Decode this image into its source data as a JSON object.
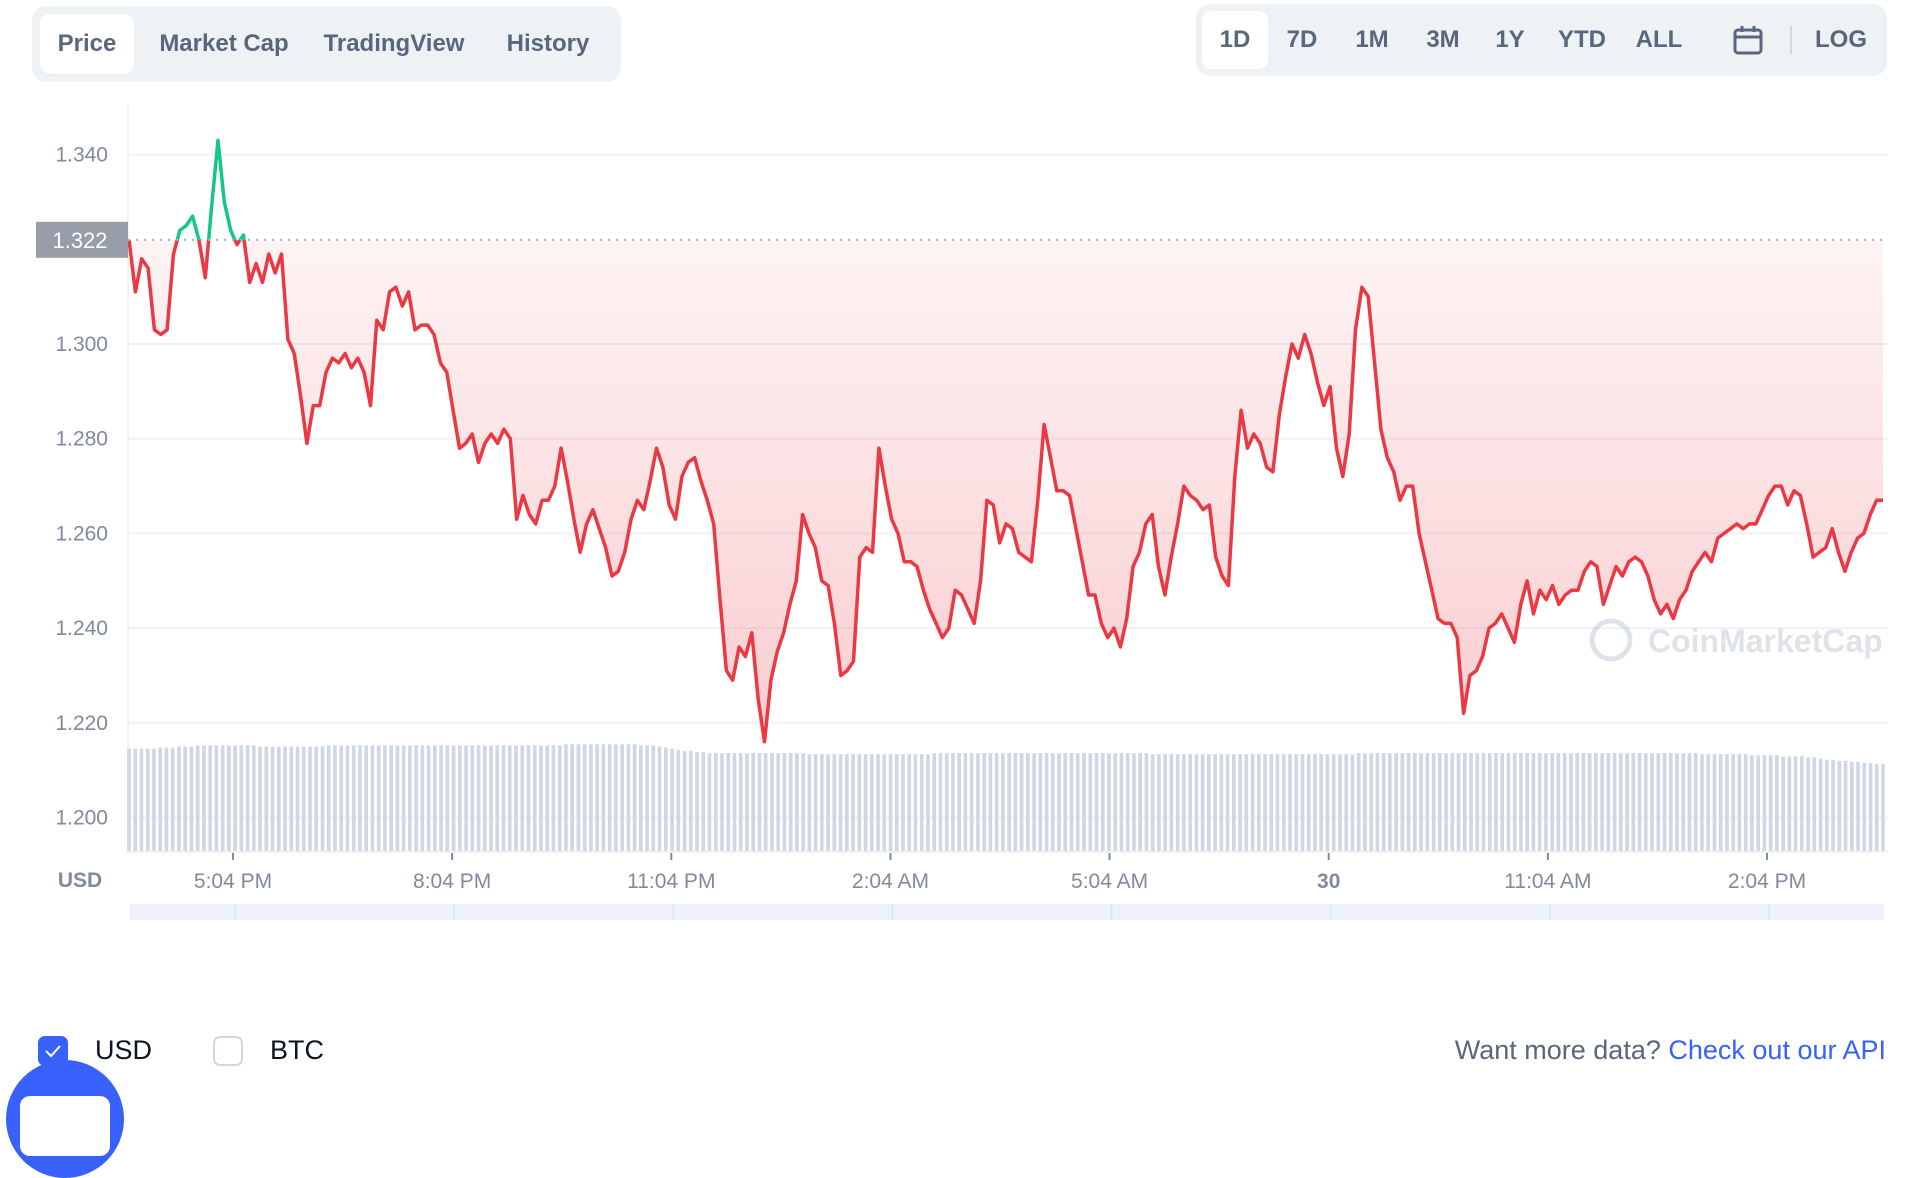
{
  "header": {
    "view_tabs": [
      {
        "label": "Price",
        "active": true
      },
      {
        "label": "Market Cap",
        "active": false
      },
      {
        "label": "TradingView",
        "active": false
      },
      {
        "label": "History",
        "active": false
      }
    ],
    "range_tabs": [
      {
        "label": "1D",
        "active": true
      },
      {
        "label": "7D",
        "active": false
      },
      {
        "label": "1M",
        "active": false
      },
      {
        "label": "3M",
        "active": false
      },
      {
        "label": "1Y",
        "active": false
      },
      {
        "label": "YTD",
        "active": false
      },
      {
        "label": "ALL",
        "active": false
      }
    ],
    "calendar_icon": "calendar-icon",
    "log_label": "LOG"
  },
  "chart_data": {
    "type": "line",
    "title": "",
    "currency_label": "USD",
    "ylabel": "",
    "xlabel": "",
    "ylim": [
      1.19,
      1.35
    ],
    "y_ticks": [
      "1.340",
      "1.300",
      "1.280",
      "1.260",
      "1.240",
      "1.220",
      "1.200"
    ],
    "y_tick_values": [
      1.34,
      1.3,
      1.28,
      1.26,
      1.24,
      1.22,
      1.2
    ],
    "x_ticks": [
      {
        "label": "5:04 PM",
        "bold": false
      },
      {
        "label": "8:04 PM",
        "bold": false
      },
      {
        "label": "11:04 PM",
        "bold": false
      },
      {
        "label": "2:04 AM",
        "bold": false
      },
      {
        "label": "5:04 AM",
        "bold": false
      },
      {
        "label": "30",
        "bold": true
      },
      {
        "label": "11:04 AM",
        "bold": false
      },
      {
        "label": "2:04 PM",
        "bold": false
      }
    ],
    "x_tick_hours": [
      1.0,
      4.0,
      7.0,
      10.0,
      13.0,
      16.0,
      19.0,
      22.0
    ],
    "x_range_hours": [
      -0.35,
      24.0
    ],
    "reference_price": 1.322,
    "reference_label": "1.322",
    "grid": true,
    "colors": {
      "up": "#16c784",
      "down": "#ea3943",
      "volume": "#cfd6e4",
      "navigator_line": "#3861fb",
      "navigator_fill": "#dde4fb"
    },
    "series": [
      {
        "name": "Price (USD)",
        "values": [
          1.322,
          1.311,
          1.318,
          1.316,
          1.303,
          1.302,
          1.303,
          1.319,
          1.324,
          1.325,
          1.327,
          1.322,
          1.314,
          1.329,
          1.343,
          1.33,
          1.324,
          1.321,
          1.323,
          1.313,
          1.317,
          1.313,
          1.319,
          1.315,
          1.319,
          1.301,
          1.298,
          1.289,
          1.279,
          1.287,
          1.287,
          1.294,
          1.297,
          1.296,
          1.298,
          1.295,
          1.297,
          1.294,
          1.287,
          1.305,
          1.303,
          1.311,
          1.312,
          1.308,
          1.311,
          1.303,
          1.304,
          1.304,
          1.302,
          1.296,
          1.294,
          1.286,
          1.278,
          1.279,
          1.281,
          1.275,
          1.279,
          1.281,
          1.279,
          1.282,
          1.28,
          1.263,
          1.268,
          1.264,
          1.262,
          1.267,
          1.267,
          1.27,
          1.278,
          1.271,
          1.263,
          1.256,
          1.262,
          1.265,
          1.261,
          1.257,
          1.251,
          1.252,
          1.256,
          1.263,
          1.267,
          1.265,
          1.271,
          1.278,
          1.274,
          1.266,
          1.263,
          1.272,
          1.275,
          1.276,
          1.271,
          1.267,
          1.262,
          1.246,
          1.231,
          1.229,
          1.236,
          1.234,
          1.239,
          1.225,
          1.216,
          1.229,
          1.235,
          1.239,
          1.245,
          1.25,
          1.264,
          1.26,
          1.257,
          1.25,
          1.249,
          1.241,
          1.23,
          1.231,
          1.233,
          1.255,
          1.257,
          1.256,
          1.278,
          1.27,
          1.263,
          1.26,
          1.254,
          1.254,
          1.253,
          1.248,
          1.244,
          1.241,
          1.238,
          1.24,
          1.248,
          1.247,
          1.244,
          1.241,
          1.25,
          1.267,
          1.266,
          1.258,
          1.262,
          1.261,
          1.256,
          1.255,
          1.254,
          1.267,
          1.283,
          1.276,
          1.269,
          1.269,
          1.268,
          1.261,
          1.254,
          1.247,
          1.247,
          1.241,
          1.238,
          1.24,
          1.236,
          1.242,
          1.253,
          1.256,
          1.262,
          1.264,
          1.253,
          1.247,
          1.255,
          1.262,
          1.27,
          1.268,
          1.267,
          1.265,
          1.266,
          1.255,
          1.251,
          1.249,
          1.272,
          1.286,
          1.278,
          1.281,
          1.279,
          1.274,
          1.273,
          1.285,
          1.293,
          1.3,
          1.297,
          1.302,
          1.298,
          1.292,
          1.287,
          1.291,
          1.278,
          1.272,
          1.281,
          1.303,
          1.312,
          1.31,
          1.296,
          1.282,
          1.276,
          1.273,
          1.267,
          1.27,
          1.27,
          1.26,
          1.254,
          1.248,
          1.242,
          1.241,
          1.241,
          1.238,
          1.222,
          1.23,
          1.231,
          1.234,
          1.24,
          1.241,
          1.243,
          1.24,
          1.237,
          1.245,
          1.25,
          1.243,
          1.248,
          1.246,
          1.249,
          1.245,
          1.247,
          1.248,
          1.248,
          1.252,
          1.254,
          1.253,
          1.245,
          1.249,
          1.253,
          1.251,
          1.254,
          1.255,
          1.254,
          1.251,
          1.246,
          1.243,
          1.245,
          1.242,
          1.246,
          1.248,
          1.252,
          1.254,
          1.256,
          1.254,
          1.259,
          1.26,
          1.261,
          1.262,
          1.261,
          1.262,
          1.262,
          1.265,
          1.268,
          1.27,
          1.27,
          1.266,
          1.269,
          1.268,
          1.262,
          1.255,
          1.256,
          1.257,
          1.261,
          1.256,
          1.252,
          1.256,
          1.259,
          1.26,
          1.264,
          1.267,
          1.267
        ]
      }
    ],
    "volume_relative": [
      0.93,
      0.93,
      0.93,
      0.93,
      0.93,
      0.94,
      0.94,
      0.94,
      0.95,
      0.95,
      0.95,
      0.96,
      0.96,
      0.96,
      0.96,
      0.96,
      0.96,
      0.96,
      0.96,
      0.96,
      0.96,
      0.95,
      0.95,
      0.95,
      0.95,
      0.95,
      0.95,
      0.95,
      0.95,
      0.95,
      0.95,
      0.95,
      0.96,
      0.96,
      0.96,
      0.96,
      0.96,
      0.96,
      0.96,
      0.96,
      0.96,
      0.96,
      0.96,
      0.96,
      0.96,
      0.96,
      0.96,
      0.96,
      0.96,
      0.96,
      0.96,
      0.96,
      0.96,
      0.96,
      0.96,
      0.96,
      0.96,
      0.96,
      0.96,
      0.96,
      0.96,
      0.96,
      0.96,
      0.96,
      0.96,
      0.96,
      0.96,
      0.96,
      0.96,
      0.96,
      0.97,
      0.97,
      0.97,
      0.97,
      0.97,
      0.97,
      0.97,
      0.97,
      0.97,
      0.97,
      0.97,
      0.97,
      0.96,
      0.96,
      0.96,
      0.95,
      0.94,
      0.93,
      0.92,
      0.91,
      0.91,
      0.9,
      0.9,
      0.89,
      0.89,
      0.89,
      0.89,
      0.89,
      0.89,
      0.89,
      0.89,
      0.89,
      0.89,
      0.89,
      0.89,
      0.89,
      0.89,
      0.89,
      0.89,
      0.88,
      0.88,
      0.88,
      0.88,
      0.88,
      0.88,
      0.88,
      0.88,
      0.88,
      0.88,
      0.88,
      0.88,
      0.88,
      0.88,
      0.88,
      0.88,
      0.88,
      0.88,
      0.88,
      0.88,
      0.89,
      0.89,
      0.89,
      0.89,
      0.89,
      0.89,
      0.89,
      0.89,
      0.89,
      0.89,
      0.89,
      0.89,
      0.89,
      0.89,
      0.89,
      0.89,
      0.89,
      0.89,
      0.89,
      0.89,
      0.89,
      0.89,
      0.89,
      0.89,
      0.89,
      0.89,
      0.89,
      0.89,
      0.89,
      0.89,
      0.89,
      0.89,
      0.89,
      0.89,
      0.89,
      0.88,
      0.88,
      0.88,
      0.88,
      0.88,
      0.88,
      0.88,
      0.88,
      0.88,
      0.88,
      0.88,
      0.88,
      0.88,
      0.88,
      0.88,
      0.88,
      0.88,
      0.88,
      0.88,
      0.88,
      0.88,
      0.88,
      0.88,
      0.88,
      0.88,
      0.88,
      0.88,
      0.88,
      0.88,
      0.88,
      0.88,
      0.88,
      0.88,
      0.89,
      0.89,
      0.89,
      0.89,
      0.89,
      0.89,
      0.89,
      0.89,
      0.89,
      0.89,
      0.89,
      0.89,
      0.89,
      0.89,
      0.89,
      0.89,
      0.89,
      0.89,
      0.89,
      0.89,
      0.89,
      0.89,
      0.89,
      0.89,
      0.89,
      0.89,
      0.89,
      0.89,
      0.89,
      0.89,
      0.89,
      0.89,
      0.89,
      0.89,
      0.89,
      0.89,
      0.89,
      0.89,
      0.89,
      0.89,
      0.89,
      0.89,
      0.89,
      0.89,
      0.89,
      0.89,
      0.89,
      0.89,
      0.89,
      0.89,
      0.89,
      0.89,
      0.89,
      0.89,
      0.89,
      0.88,
      0.88,
      0.88,
      0.88,
      0.88,
      0.88,
      0.88,
      0.88,
      0.87,
      0.87,
      0.87,
      0.87,
      0.87,
      0.86,
      0.86,
      0.86,
      0.86,
      0.85,
      0.85,
      0.84,
      0.83,
      0.83,
      0.82,
      0.82,
      0.81,
      0.81,
      0.8,
      0.8,
      0.79,
      0.79
    ],
    "watermark": "CoinMarketCap"
  },
  "navigator": {
    "x_labels": [
      "5:04 PM",
      "8:04 PM",
      "11:04 PM",
      "2:04 AM",
      "5:04 AM",
      "30",
      "11:04 AM",
      "2:04 PM"
    ]
  },
  "footer": {
    "currency_toggles": [
      {
        "label": "USD",
        "checked": true
      },
      {
        "label": "BTC",
        "checked": false
      }
    ],
    "api_prompt": "Want more data?",
    "api_link": "Check out our API"
  }
}
